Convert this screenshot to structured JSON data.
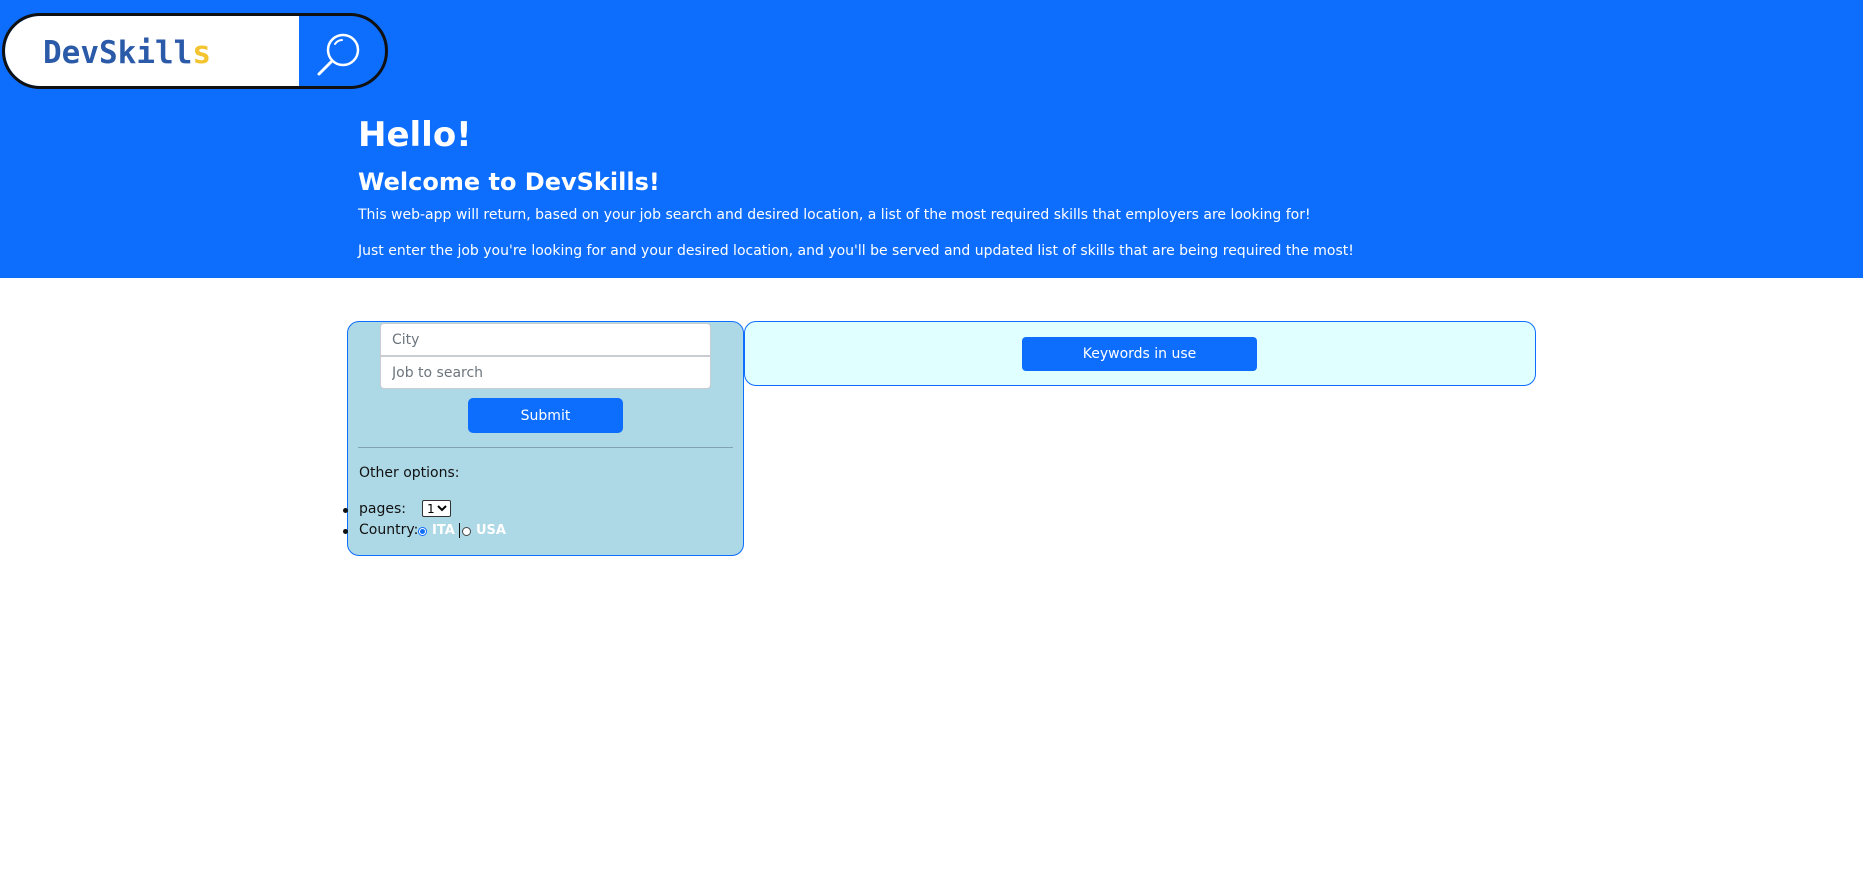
{
  "logo": {
    "text_main": "DevSkill",
    "text_last": "s",
    "icon": "search-icon"
  },
  "hero": {
    "hello": "Hello!",
    "welcome": "Welcome to DevSkills!",
    "description_1": "This web-app will return, based on your job search and desired location, a list of the most required skills that employers are looking for!",
    "description_2": "Just enter the job you're looking for and your desired location, and you'll be served and updated list of skills that are being required the most!"
  },
  "search_form": {
    "city_placeholder": "City",
    "job_placeholder": "Job to search",
    "submit_label": "Submit"
  },
  "options": {
    "heading": "Other options:",
    "pages_label": "pages:",
    "pages_selected": "1",
    "country_label": "Country:",
    "countries": [
      {
        "label": "ITA",
        "checked": true
      },
      {
        "label": "USA",
        "checked": false
      }
    ]
  },
  "keywords": {
    "button_label": "Keywords in use"
  },
  "colors": {
    "primary": "#0d6efd",
    "left_panel_bg": "#add8e6",
    "right_panel_bg": "#e0ffff",
    "logo_text": "#2a5aa8",
    "logo_accent": "#f4c430"
  }
}
